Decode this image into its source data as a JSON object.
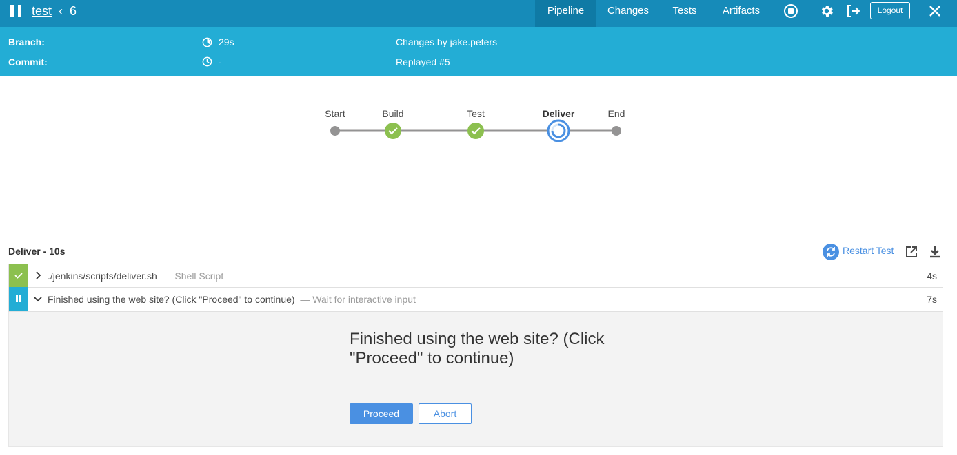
{
  "header": {
    "job_name": "test",
    "chevron": "‹",
    "run_number": "6",
    "tabs": [
      {
        "label": "Pipeline",
        "active": true
      },
      {
        "label": "Changes",
        "active": false
      },
      {
        "label": "Tests",
        "active": false
      },
      {
        "label": "Artifacts",
        "active": false
      }
    ],
    "icons": [
      "stop-icon",
      "gear-icon",
      "exit-icon",
      "close-icon"
    ],
    "logout_label": "Logout",
    "color": "#168bb9"
  },
  "info": {
    "branch_label": "Branch:",
    "branch_value": "–",
    "commit_label": "Commit:",
    "commit_value": "–",
    "duration": "29s",
    "time_ago": "-",
    "changes": "Changes by jake.peters",
    "replayed": "Replayed #5",
    "color": "#23add5"
  },
  "pipeline": {
    "stages": [
      {
        "name": "Start",
        "status": "none"
      },
      {
        "name": "Build",
        "status": "success"
      },
      {
        "name": "Test",
        "status": "success"
      },
      {
        "name": "Deliver",
        "status": "running",
        "selected": true
      },
      {
        "name": "End",
        "status": "none"
      }
    ],
    "success_color": "#8cc04f",
    "running_color": "#4a90e2"
  },
  "section": {
    "title": "Deliver - 10s",
    "restart_label": "Restart Test"
  },
  "steps": [
    {
      "title": "./jenkins/scripts/deliver.sh",
      "subtitle": "— Shell Script",
      "time": "4s",
      "status": "success",
      "expanded": false
    },
    {
      "title": "Finished using the web site? (Click \"Proceed\" to continue)",
      "subtitle": "— Wait for interactive input",
      "time": "7s",
      "status": "paused",
      "expanded": true
    }
  ],
  "input": {
    "message": "Finished using the web site? (Click \"Proceed\" to continue)",
    "proceed_label": "Proceed",
    "abort_label": "Abort"
  }
}
